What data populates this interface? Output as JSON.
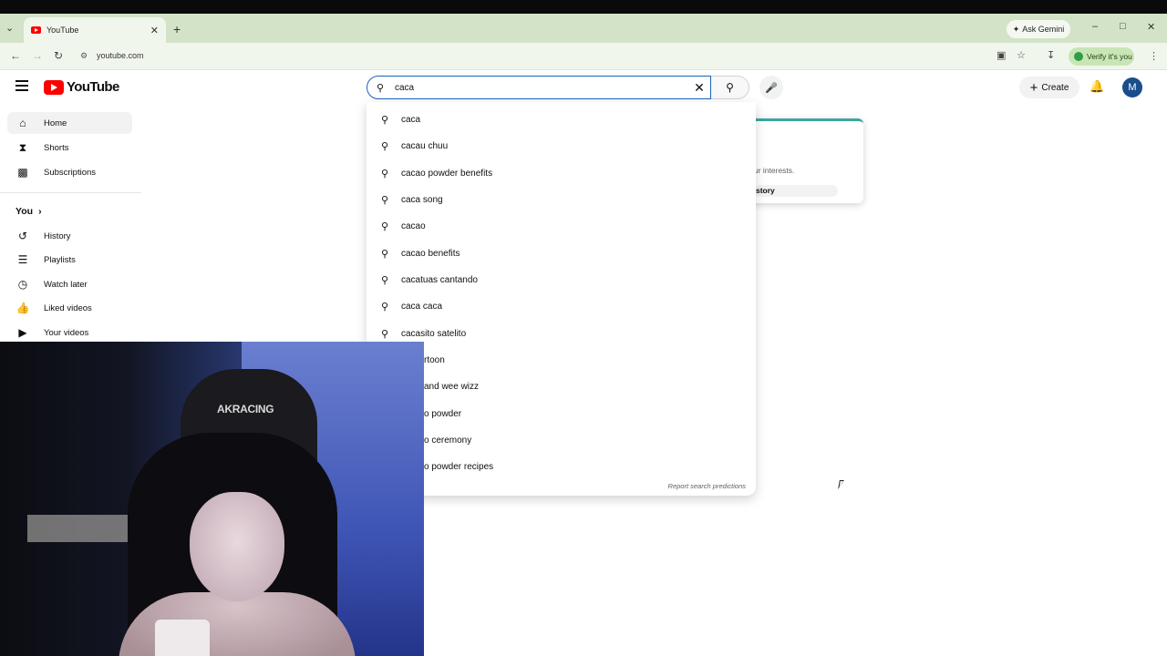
{
  "browser": {
    "tab_title": "YouTube",
    "url": "youtube.com",
    "ask_gemini": "Ask Gemini",
    "verify_label": "Verify it's you"
  },
  "youtube": {
    "logo_text": "YouTube",
    "search_value": "caca",
    "create_label": "Create",
    "avatar_letter": "M",
    "accent": "#ff0000"
  },
  "sidebar": {
    "items": [
      {
        "label": "Home",
        "icon": "home-icon"
      },
      {
        "label": "Shorts",
        "icon": "shorts-icon"
      },
      {
        "label": "Subscriptions",
        "icon": "subscriptions-icon"
      }
    ],
    "you_heading": "You",
    "you_items": [
      {
        "label": "History",
        "icon": "history-icon"
      },
      {
        "label": "Playlists",
        "icon": "playlists-icon"
      },
      {
        "label": "Watch later",
        "icon": "watch-later-icon"
      },
      {
        "label": "Liked videos",
        "icon": "liked-videos-icon"
      },
      {
        "label": "Your videos",
        "icon": "your-videos-icon"
      }
    ]
  },
  "suggestions": [
    "caca",
    "cacau chuu",
    "cacao powder benefits",
    "caca song",
    "cacao",
    "cacao benefits",
    "cacatuas cantando",
    "caca caca",
    "cacasito satelito",
    "rtoon",
    "and wee wizz",
    "o powder",
    "o ceremony",
    "o powder recipes"
  ],
  "report_label": "Report search predictions",
  "card": {
    "text": "ur interests.",
    "button": "story"
  },
  "webcam": {
    "chair_brand": "AKRACING"
  }
}
